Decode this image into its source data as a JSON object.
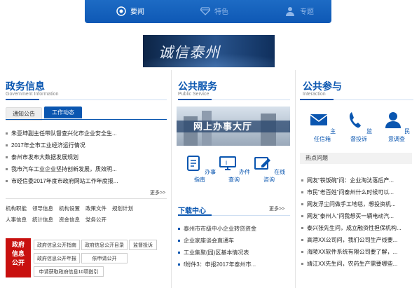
{
  "topnav": {
    "items": [
      {
        "label": "要闻",
        "icon": "target-icon"
      },
      {
        "label": "特色",
        "icon": "diamond-icon"
      },
      {
        "label": "专题",
        "icon": "people-icon"
      }
    ]
  },
  "banner": {
    "text": "诚信泰州"
  },
  "gov_info": {
    "title": "政务信息",
    "subtitle": "Government Information",
    "tabs": [
      "通知公告",
      "工作动态"
    ],
    "news": [
      "朱亚坤副主任带队督查兴化市企业安全生...",
      "2017年全市工业经济运行情况",
      "泰州市发布大数据发展规划",
      "我市汽车工业企业坚持创新发展，质效明...",
      "市经信委2017年度市政府网站工作年度报..."
    ],
    "more": "更多>>",
    "links": [
      [
        "机构职能",
        "领导信息",
        "机构设置",
        "政策文件",
        "规划计划"
      ],
      [
        "人事信息",
        "统计信息",
        "资金信息",
        "党务公开"
      ]
    ],
    "gov_open_label": "政府信息公开",
    "gov_open_buttons": [
      "政府信息公开指南",
      "政府信息公开目录",
      "监督投诉",
      "政府信息公开年报",
      "依申请公开",
      "申请获取政府信息10项指引"
    ]
  },
  "public_service": {
    "title": "公共服务",
    "subtitle": "Public Service",
    "hall_text": "网上办事大厅",
    "services": [
      {
        "label": "办事指南",
        "icon": "document-icon"
      },
      {
        "label": "办件查询",
        "icon": "monitor-icon"
      },
      {
        "label": "在线咨询",
        "icon": "edit-icon"
      }
    ],
    "download": {
      "title": "下载中心",
      "more": "更多>>",
      "items": [
        "泰州市市级中小企业转贷资金",
        "企业家座谈会直通车",
        "工业集聚(园)区基本情况表",
        "f附件3：申报2017年泰州市..."
      ]
    }
  },
  "interaction": {
    "title": "公共参与",
    "subtitle": "Interaction",
    "actions": [
      {
        "label": "主任信箱",
        "icon": "mail-icon"
      },
      {
        "label": "监督投诉",
        "icon": "phone-icon"
      },
      {
        "label": "民意调查",
        "icon": "user-icon"
      }
    ],
    "hot_title": "热点问题",
    "hot": [
      "网友“铁饭碗”问：企业淘汰落后产...",
      "市民“老百姓”问泰州什么时候可以...",
      "网友浮尘问做手工地毯，想投资机...",
      "网友“泰州人”问我想买一辆电动汽...",
      "泰兴张先生问，成立融资性担保机构...",
      "高港XX公司问，我们公司生产线要...",
      "海陵XX软件系统有限公司要了解，...",
      "靖江XX先生问，农药生产需要哪些..."
    ]
  },
  "colors": {
    "brand": "#0a56b0",
    "gov_red": "#c8100f"
  }
}
